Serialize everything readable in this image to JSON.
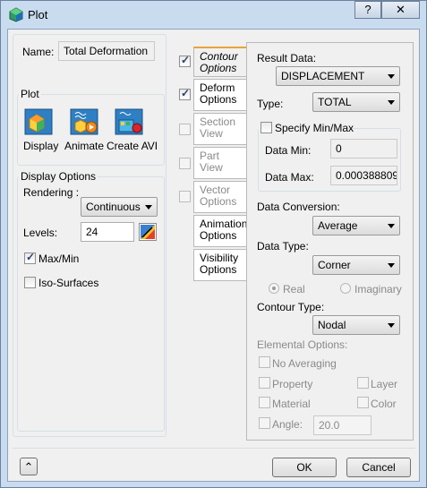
{
  "window": {
    "title": "Plot",
    "help_glyph": "?",
    "close_glyph": "✕"
  },
  "left": {
    "name_label": "Name:",
    "name_value": "Total Deformation",
    "plot_group": "Plot",
    "display_label": "Display",
    "animate_label": "Animate",
    "create_avi_label": "Create AVI",
    "display_options_group": "Display Options",
    "rendering_label": "Rendering :",
    "rendering_value": "Continuous",
    "levels_label": "Levels:",
    "levels_value": "24",
    "maxmin_label": "Max/Min",
    "maxmin_checked": true,
    "isosurfaces_label": "Iso-Surfaces",
    "isosurfaces_checked": false
  },
  "tabs": [
    {
      "line1": "Contour",
      "line2": "Options",
      "checked": true,
      "enabled": true,
      "active": true
    },
    {
      "line1": "Deform",
      "line2": "Options",
      "checked": true,
      "enabled": true,
      "active": false
    },
    {
      "line1": "Section",
      "line2": "View",
      "checked": false,
      "enabled": false,
      "active": false
    },
    {
      "line1": "Part View",
      "line2": "",
      "checked": false,
      "enabled": false,
      "active": false
    },
    {
      "line1": "Vector",
      "line2": "Options",
      "checked": false,
      "enabled": false,
      "active": false
    },
    {
      "line1": "Animation",
      "line2": "Options",
      "checked": null,
      "enabled": true,
      "active": false
    },
    {
      "line1": "Visibility",
      "line2": "Options",
      "checked": null,
      "enabled": true,
      "active": false
    }
  ],
  "contour": {
    "result_data_label": "Result Data:",
    "result_data_value": "DISPLACEMENT",
    "type_label": "Type:",
    "type_value": "TOTAL",
    "specify_minmax_label": "Specify Min/Max",
    "specify_minmax_checked": false,
    "data_min_label": "Data Min:",
    "data_min_value": "0",
    "data_max_label": "Data Max:",
    "data_max_value": "0.000388809",
    "data_conversion_label": "Data Conversion:",
    "data_conversion_value": "Average",
    "data_type_label": "Data Type:",
    "data_type_value": "Corner",
    "real_label": "Real",
    "imaginary_label": "Imaginary",
    "contour_type_label": "Contour Type:",
    "contour_type_value": "Nodal",
    "elemental_options_label": "Elemental Options:",
    "no_averaging_label": "No Averaging",
    "property_label": "Property",
    "layer_label": "Layer",
    "material_label": "Material",
    "color_label": "Color",
    "angle_label": "Angle:",
    "angle_value": "20.0"
  },
  "footer": {
    "collapse_glyph": "⌃",
    "ok_label": "OK",
    "cancel_label": "Cancel"
  },
  "colors": {
    "accent_tab": "#e8a33a",
    "window_frame": "#c9dcef"
  }
}
